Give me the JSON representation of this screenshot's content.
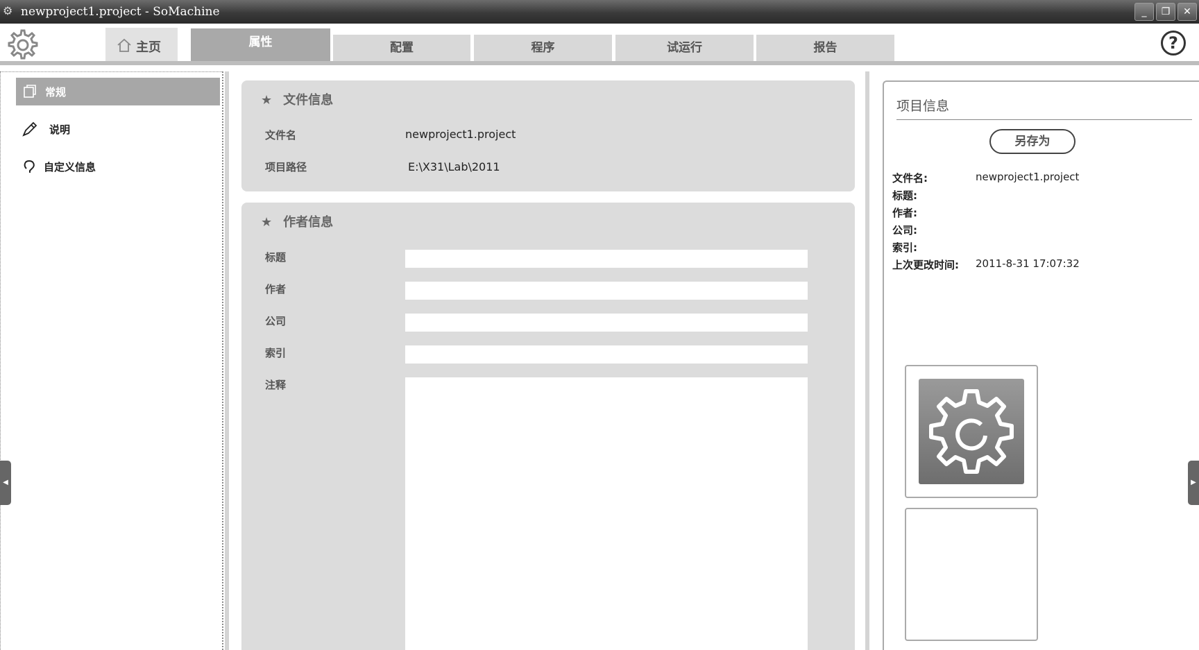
{
  "window": {
    "title": "newproject1.project - SoMachine"
  },
  "tabs": {
    "home": "主页",
    "items": [
      "属性",
      "配置",
      "程序",
      "试运行",
      "报告"
    ]
  },
  "sidebar": {
    "items": [
      {
        "label": "常规",
        "icon": "general-icon"
      },
      {
        "label": "说明",
        "icon": "pen-icon"
      },
      {
        "label": "自定义信息",
        "icon": "custom-info-icon"
      }
    ]
  },
  "file_info": {
    "header": "文件信息",
    "name_label": "文件名",
    "name_value": "newproject1.project",
    "path_label": "项目路径",
    "path_value": "E:\\X31\\Lab\\2011"
  },
  "author_info": {
    "header": "作者信息",
    "fields": [
      "标题",
      "作者",
      "公司",
      "索引",
      "注释"
    ]
  },
  "project_info": {
    "header": "项目信息",
    "save_as": "另存为",
    "labels": [
      "文件名:",
      "标题:",
      "作者:",
      "公司:",
      "索引:",
      "上次更改时间:"
    ],
    "file_name": "newproject1.project",
    "last_modified": "2011-8-31 17:07:32"
  }
}
